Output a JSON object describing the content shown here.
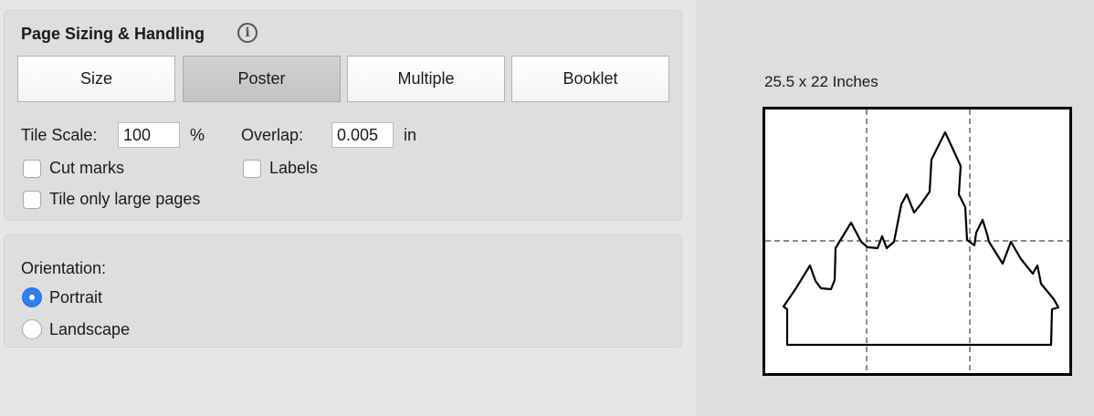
{
  "panel": {
    "title": "Page Sizing & Handling",
    "info_glyph": "i",
    "modes": [
      "Size",
      "Poster",
      "Multiple",
      "Booklet"
    ],
    "selected_mode": "Poster",
    "tile_scale_label": "Tile Scale:",
    "tile_scale_value": "100",
    "tile_scale_unit": "%",
    "overlap_label": "Overlap:",
    "overlap_value": "0.005",
    "overlap_unit": "in",
    "cut_marks_label": "Cut marks",
    "cut_marks_checked": false,
    "labels_label": "Labels",
    "labels_checked": false,
    "tile_large_label": "Tile only large pages",
    "tile_large_checked": false
  },
  "orientation": {
    "label": "Orientation:",
    "portrait_label": "Portrait",
    "landscape_label": "Landscape",
    "selected": "Portrait"
  },
  "preview": {
    "dimensions": "25.5 x 22 Inches",
    "tiles_across": 3,
    "tiles_down": 2,
    "icon": "castle-silhouette-icon"
  },
  "colors": {
    "accent": "#2f7ef6",
    "selected_segment": "#c8c8c8"
  }
}
